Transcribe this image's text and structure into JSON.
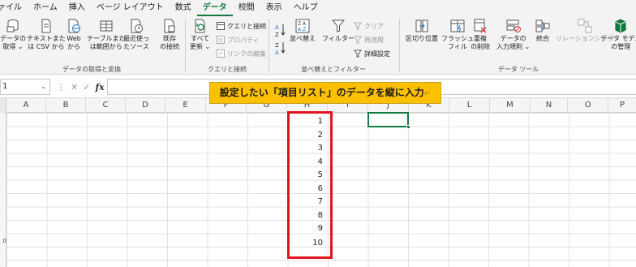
{
  "menu": {
    "tabs": [
      "ァイル",
      "ホーム",
      "挿入",
      "ページ レイアウト",
      "数式",
      "データ",
      "校閲",
      "表示",
      "ヘルプ"
    ],
    "active_tab": "データ"
  },
  "ribbon": {
    "get_data": {
      "label": "データの取得と変換",
      "buttons": [
        {
          "line1": "データの",
          "line2": "取得 ⌄"
        },
        {
          "line1": "テキストまた",
          "line2": "は CSV から"
        },
        {
          "line1": "Web",
          "line2": "から"
        },
        {
          "line1": "テーブルまた",
          "line2": "は範囲から"
        },
        {
          "line1": "最近使っ",
          "line2": "たソース"
        },
        {
          "line1": "既存",
          "line2": "の接続"
        }
      ]
    },
    "queries": {
      "label": "クエリと接続",
      "refresh": {
        "line1": "すべて",
        "line2": "更新 ⌄"
      },
      "small": [
        "クエリと接続",
        "プロパティ",
        "リンクの編集"
      ]
    },
    "sort_filter": {
      "label": "並べ替えとフィルター",
      "sort": "並べ替え",
      "filter": "フィルター",
      "small": [
        "クリア",
        "再適用",
        "詳細設定"
      ]
    },
    "data_tools": {
      "label": "データ ツール",
      "buttons": [
        {
          "line1": "区切り位置",
          "line2": ""
        },
        {
          "line1": "フラッシュ",
          "line2": "フィル"
        },
        {
          "line1": "重複",
          "line2": "の削除"
        },
        {
          "line1": "データの",
          "line2": "入力規則 ⌄"
        },
        {
          "line1": "統合",
          "line2": ""
        },
        {
          "line1": "リレーションシップ",
          "line2": ""
        },
        {
          "line1": "データ モデル",
          "line2": "の管理"
        }
      ]
    }
  },
  "formula_bar": {
    "name_box": "1",
    "fx": "fx",
    "formula": ""
  },
  "columns": [
    "A",
    "B",
    "C",
    "D",
    "E",
    "F",
    "G",
    "H",
    "I",
    "J",
    "K",
    "L",
    "M",
    "N",
    "O",
    "P"
  ],
  "row_headers": [
    "",
    "",
    "",
    "",
    "",
    "",
    "",
    "",
    "",
    "0"
  ],
  "cell_values": [
    "1",
    "2",
    "3",
    "4",
    "5",
    "6",
    "7",
    "8",
    "9",
    "10"
  ],
  "callout": {
    "text": "設定したい「項目リスト」のデータを縦に入力",
    "return_mark": "↵"
  },
  "colors": {
    "accent": "#107c41",
    "highlight_border": "#e0141e",
    "callout_bg": "#ffc000"
  }
}
